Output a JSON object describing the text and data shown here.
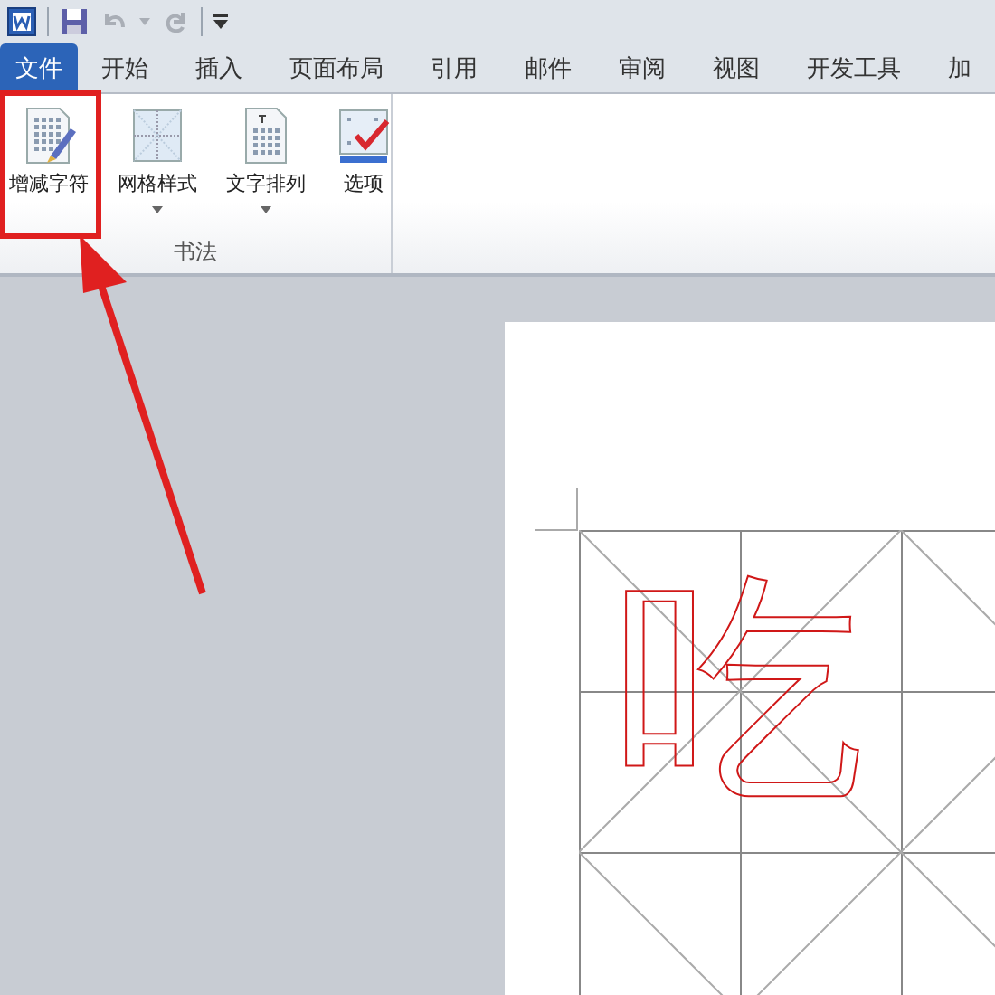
{
  "tabs": [
    {
      "label": "文件",
      "kind": "file",
      "selected": false
    },
    {
      "label": "开始",
      "kind": "tab",
      "selected": false
    },
    {
      "label": "插入",
      "kind": "tab",
      "selected": false
    },
    {
      "label": "页面布局",
      "kind": "tab",
      "selected": false
    },
    {
      "label": "引用",
      "kind": "tab",
      "selected": false
    },
    {
      "label": "邮件",
      "kind": "tab",
      "selected": false
    },
    {
      "label": "审阅",
      "kind": "tab",
      "selected": false
    },
    {
      "label": "视图",
      "kind": "tab",
      "selected": false
    },
    {
      "label": "开发工具",
      "kind": "tab",
      "selected": false
    },
    {
      "label": "加",
      "kind": "tab",
      "selected": false
    }
  ],
  "ribbon_group": {
    "label": "书法",
    "buttons": [
      {
        "label": "增减字符",
        "kind": "chars",
        "has_dropdown": false
      },
      {
        "label": "网格样式",
        "kind": "grid",
        "has_dropdown": true
      },
      {
        "label": "文字排列",
        "kind": "arrange",
        "has_dropdown": true
      },
      {
        "label": "选项",
        "kind": "options",
        "has_dropdown": false
      }
    ]
  },
  "document": {
    "characters": [
      {
        "text": "吃"
      }
    ]
  },
  "annotation": {
    "highlight": true,
    "arrow": true
  }
}
